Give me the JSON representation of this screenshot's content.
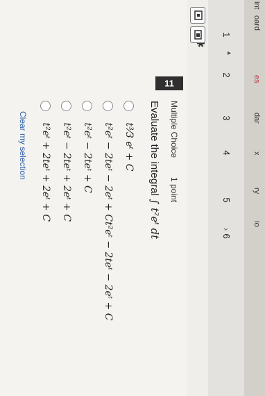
{
  "nav": {
    "items": [
      {
        "label": "int",
        "active": false
      },
      {
        "label": "oard",
        "active": false
      },
      {
        "label": "es",
        "active": true
      },
      {
        "label": "dar",
        "active": false
      },
      {
        "label": "x",
        "active": false
      },
      {
        "label": "ry",
        "active": false
      },
      {
        "label": "io",
        "active": false
      }
    ]
  },
  "question_nav": {
    "numbers": [
      "1",
      "2",
      "3",
      "4",
      "5",
      "6"
    ],
    "arrow": "▲",
    "bullet": "›"
  },
  "toolbar": {
    "pin_icon": "✱"
  },
  "question": {
    "number": "11",
    "type": "Multiple Choice",
    "points": "1 point",
    "prompt_text": "Evaluate the integral",
    "prompt_math": "∫ t²eᵗ dt",
    "choices": [
      {
        "id": "a",
        "text": "t³⁄3 eᵗ + C"
      },
      {
        "id": "b",
        "text": "t²eᵗ − 2teᵗ − 2eᵗ + Ct²eᵗ − 2teᵗ − 2eᵗ + C"
      },
      {
        "id": "c",
        "text": "t²eᵗ − 2teᵗ + C"
      },
      {
        "id": "d",
        "text": "t²eᵗ − 2teᵗ + 2eᵗ + C"
      },
      {
        "id": "e",
        "text": "t²eᵗ + 2teᵗ + 2eᵗ + C"
      }
    ],
    "clear_label": "Clear my selection"
  }
}
